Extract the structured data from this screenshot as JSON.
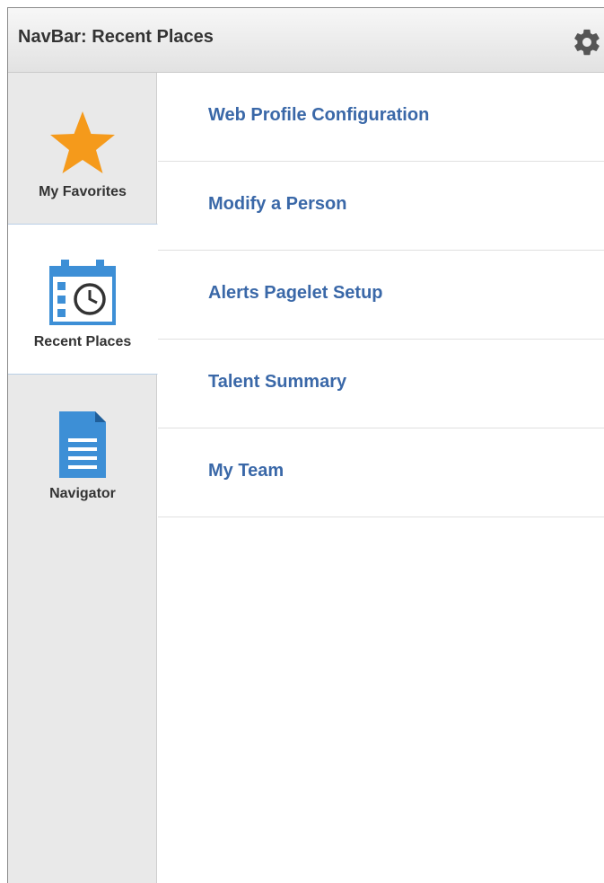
{
  "header": {
    "title": "NavBar: Recent Places",
    "settings_icon": "gear-icon"
  },
  "sidebar": {
    "items": [
      {
        "label": "My Favorites",
        "icon": "star-icon",
        "color": "#f59a1b"
      },
      {
        "label": "Recent Places",
        "icon": "calendar-clock-icon",
        "color": "#3d8fd6",
        "selected": true
      },
      {
        "label": "Navigator",
        "icon": "document-icon",
        "color": "#3d8fd6"
      }
    ]
  },
  "recent_places": {
    "items": [
      {
        "label": "Web Profile Configuration"
      },
      {
        "label": "Modify a Person"
      },
      {
        "label": "Alerts Pagelet Setup"
      },
      {
        "label": "Talent Summary"
      },
      {
        "label": "My Team"
      }
    ]
  },
  "colors": {
    "link": "#3a68a8",
    "header_text": "#333333",
    "sidebar_bg": "#e9e9e9"
  }
}
